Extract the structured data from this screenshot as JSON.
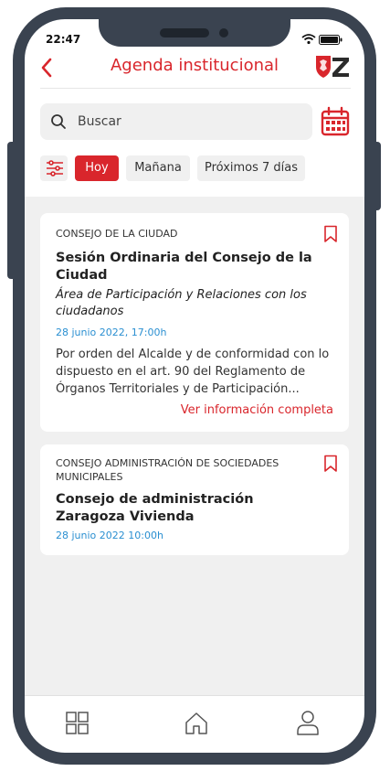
{
  "status_bar": {
    "time": "22:47"
  },
  "header": {
    "title": "Agenda institucional"
  },
  "search": {
    "placeholder": "Buscar"
  },
  "filters": {
    "chips": [
      "Hoy",
      "Mañana",
      "Próximos 7 días"
    ],
    "selected": "Hoy"
  },
  "colors": {
    "accent": "#d9262c",
    "date": "#2a8fd1",
    "frame": "#3a4350",
    "background": "#f0f0f0"
  },
  "events": [
    {
      "category": "CONSEJO DE LA CIUDAD",
      "title": "Sesión Ordinaria del Consejo de la Ciudad",
      "subtitle": "Área de Participación y Relaciones con los ciudadanos",
      "date": "28 junio 2022, 17:00h",
      "description": "Por orden del Alcalde y de conformidad con lo dispuesto en el art. 90 del Reglamento de Órganos Territoriales y de Participación...",
      "more_link": "Ver información completa"
    },
    {
      "category": "CONSEJO ADMINISTRACIÓN DE SOCIEDADES MUNICIPALES",
      "title": "Consejo de administración Zaragoza Vivienda",
      "date": "28 junio 2022 10:00h"
    }
  ],
  "tabbar": {
    "icons": [
      "grid-icon",
      "home-icon",
      "user-icon"
    ]
  }
}
